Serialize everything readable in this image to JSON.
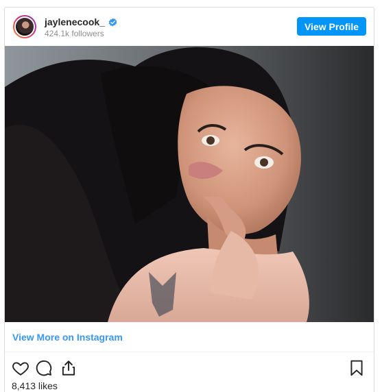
{
  "post": {
    "username": "jaylenecook_",
    "followers_text": "424.1k followers",
    "view_profile_label": "View Profile",
    "view_more_label": "View More on Instagram",
    "likes_text": "8,413 likes"
  },
  "icons": {
    "verified": "verified-badge-icon",
    "like": "heart-icon",
    "comment": "comment-icon",
    "share": "share-icon",
    "save": "bookmark-icon"
  },
  "colors": {
    "accent": "#0095f6",
    "link": "#3897f0",
    "verified": "#3897f0",
    "muted": "#8e8e8e"
  }
}
